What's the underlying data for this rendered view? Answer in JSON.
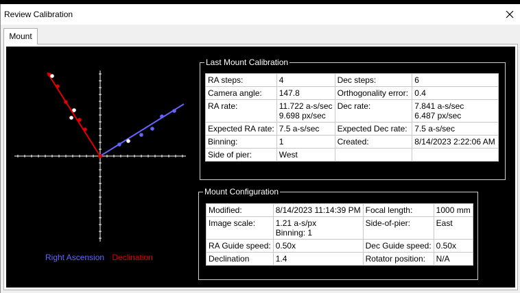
{
  "window": {
    "title": "Review Calibration"
  },
  "tabs": [
    {
      "label": "Mount"
    }
  ],
  "legend": {
    "ra": "Right Ascension",
    "dec": "Declination"
  },
  "colors": {
    "ra": "#6464ff",
    "dec": "#e00000",
    "axis": "#ffffff"
  },
  "chart_data": {
    "type": "scatter",
    "series": [
      {
        "name": "Right Ascension",
        "line": [
          [
            0,
            0
          ],
          [
            122,
            76
          ]
        ],
        "points": [
          [
            28,
            17
          ],
          [
            41,
            22
          ],
          [
            60,
            31
          ],
          [
            76,
            40
          ],
          [
            90,
            58
          ],
          [
            108,
            66
          ]
        ]
      },
      {
        "name": "Declination",
        "line": [
          [
            0,
            0
          ],
          [
            -77,
            122
          ]
        ],
        "points": [
          [
            -74,
            119
          ],
          [
            -70,
            117
          ],
          [
            -62,
            102
          ],
          [
            -50,
            79
          ],
          [
            -40,
            66
          ],
          [
            -38,
            67
          ],
          [
            -30,
            53
          ],
          [
            -42,
            56
          ],
          [
            -22,
            39
          ]
        ]
      }
    ]
  },
  "last_calibration": {
    "title": "Last Mount Calibration",
    "rows": [
      [
        "RA steps:",
        "4",
        "Dec steps:",
        "6"
      ],
      [
        "Camera angle:",
        "147.8",
        "Orthogonality error:",
        "0.4"
      ],
      [
        "RA rate:",
        "11.722 a-s/sec\n9.698 px/sec",
        "Dec rate:",
        "7.841 a-s/sec\n6.487 px/sec"
      ],
      [
        "Expected RA rate:",
        "7.5 a-s/sec",
        "Expected Dec rate:",
        "7.5 a-s/sec"
      ],
      [
        "Binning:",
        "1",
        "Created:",
        "8/14/2023 2:22:06 AM"
      ],
      [
        "Side of pier:",
        "West",
        "",
        ""
      ]
    ]
  },
  "mount_config": {
    "title": "Mount Configuration",
    "rows": [
      [
        "Modified:",
        "8/14/2023 11:14:39 PM",
        "Focal length:",
        "1000 mm"
      ],
      [
        "Image scale:",
        "1.21 a-s/px\nBinning: 1",
        "Side-of-pier:",
        "East"
      ],
      [
        "RA Guide speed:",
        "0.50x",
        "Dec Guide speed:",
        "0.50x"
      ],
      [
        "Declination",
        "1.4",
        "Rotator position:",
        "N/A"
      ]
    ]
  }
}
